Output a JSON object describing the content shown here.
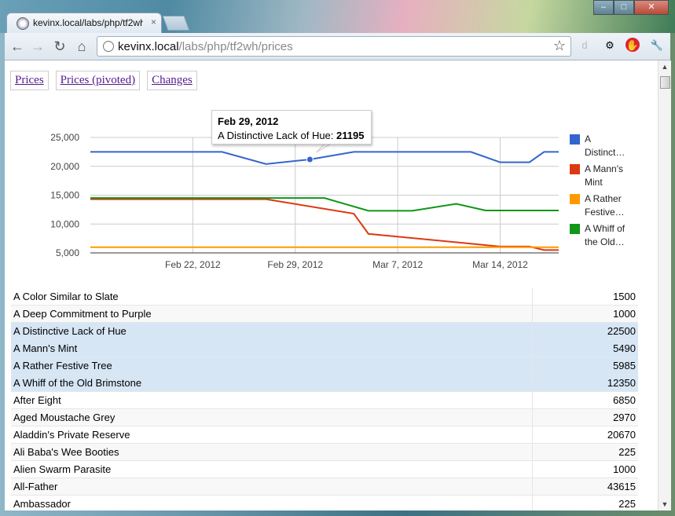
{
  "browser": {
    "tab_title": "kevinx.local/labs/php/tf2wh",
    "tab_close": "×",
    "url_host": "kevinx.local",
    "url_path": "/labs/php/tf2wh/prices",
    "window_buttons": [
      "‒",
      "□",
      "✕"
    ]
  },
  "nav": {
    "links": [
      "Prices",
      "Prices (pivoted)",
      "Changes"
    ]
  },
  "tooltip": {
    "date": "Feb 29, 2012",
    "series": "A Distinctive Lack of Hue",
    "value": "21195"
  },
  "chart_data": {
    "type": "line",
    "x": [
      "2012-02-19",
      "2012-02-22",
      "2012-02-26",
      "2012-02-29",
      "2012-03-03",
      "2012-03-06",
      "2012-03-10",
      "2012-03-12",
      "2012-03-14",
      "2012-03-15",
      "2012-03-16"
    ],
    "x_tick_labels": [
      "Feb 22, 2012",
      "Feb 29, 2012",
      "Mar 7, 2012",
      "Mar 14, 2012"
    ],
    "ylim": [
      5000,
      25000
    ],
    "y_tick_labels": [
      "25,000",
      "20,000",
      "15,000",
      "10,000",
      "5,000"
    ],
    "grid": true,
    "legend_position": "right",
    "series": [
      {
        "name": "A Distinct…",
        "legend_label_full": "A Distinctive Lack of Hue",
        "color": "#3366cc",
        "points": [
          [
            "2012-02-15",
            22500
          ],
          [
            "2012-02-24",
            22500
          ],
          [
            "2012-02-27",
            20400
          ],
          [
            "2012-03-01",
            21195
          ],
          [
            "2012-03-04",
            22500
          ],
          [
            "2012-03-12",
            22500
          ],
          [
            "2012-03-14",
            20700
          ],
          [
            "2012-03-16",
            20700
          ],
          [
            "2012-03-17",
            22500
          ],
          [
            "2012-03-18",
            22500
          ]
        ]
      },
      {
        "name": "A Mann's Mint",
        "color": "#dc3912",
        "points": [
          [
            "2012-02-15",
            14300
          ],
          [
            "2012-02-27",
            14300
          ],
          [
            "2012-03-04",
            11800
          ],
          [
            "2012-03-05",
            8300
          ],
          [
            "2012-03-12",
            6600
          ],
          [
            "2012-03-14",
            6100
          ],
          [
            "2012-03-16",
            6100
          ],
          [
            "2012-03-17",
            5490
          ],
          [
            "2012-03-18",
            5490
          ]
        ]
      },
      {
        "name": "A Rather Festive…",
        "color": "#ff9900",
        "points": [
          [
            "2012-02-15",
            5985
          ],
          [
            "2012-03-18",
            5985
          ]
        ]
      },
      {
        "name": "A Whiff of the Old…",
        "color": "#109618",
        "points": [
          [
            "2012-02-15",
            14500
          ],
          [
            "2012-03-02",
            14500
          ],
          [
            "2012-03-05",
            12300
          ],
          [
            "2012-03-08",
            12300
          ],
          [
            "2012-03-11",
            13500
          ],
          [
            "2012-03-13",
            12350
          ],
          [
            "2012-03-18",
            12350
          ]
        ]
      }
    ],
    "legend": [
      {
        "lines": [
          "A",
          "Distinct…"
        ],
        "color": "#3366cc"
      },
      {
        "lines": [
          "A Mann's",
          "Mint"
        ],
        "color": "#dc3912"
      },
      {
        "lines": [
          "A Rather",
          "Festive…"
        ],
        "color": "#ff9900"
      },
      {
        "lines": [
          "A Whiff of",
          "the Old…"
        ],
        "color": "#109618"
      }
    ],
    "highlight_point": {
      "x": "2012-03-01",
      "y": 21195,
      "series": "A Distinct…"
    }
  },
  "table": {
    "rows": [
      {
        "name": "A Color Similar to Slate",
        "value": "1500",
        "selected": false
      },
      {
        "name": "A Deep Commitment to Purple",
        "value": "1000",
        "selected": false
      },
      {
        "name": "A Distinctive Lack of Hue",
        "value": "22500",
        "selected": true
      },
      {
        "name": "A Mann's Mint",
        "value": "5490",
        "selected": true
      },
      {
        "name": "A Rather Festive Tree",
        "value": "5985",
        "selected": true
      },
      {
        "name": "A Whiff of the Old Brimstone",
        "value": "12350",
        "selected": true
      },
      {
        "name": "After Eight",
        "value": "6850",
        "selected": false
      },
      {
        "name": "Aged Moustache Grey",
        "value": "2970",
        "selected": false
      },
      {
        "name": "Aladdin's Private Reserve",
        "value": "20670",
        "selected": false
      },
      {
        "name": "Ali Baba's Wee Booties",
        "value": "225",
        "selected": false
      },
      {
        "name": "Alien Swarm Parasite",
        "value": "1000",
        "selected": false
      },
      {
        "name": "All-Father",
        "value": "43615",
        "selected": false
      },
      {
        "name": "Ambassador",
        "value": "225",
        "selected": false
      }
    ]
  }
}
